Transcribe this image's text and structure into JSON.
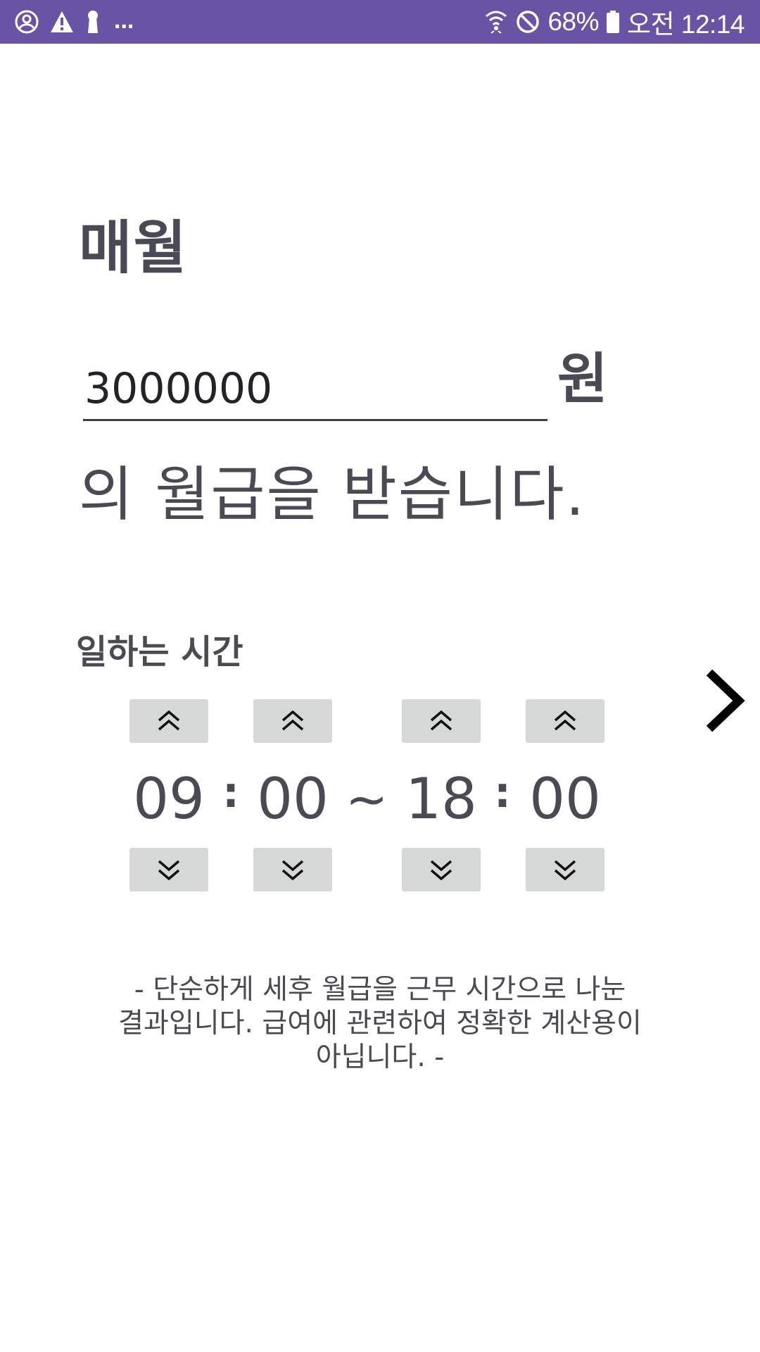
{
  "status_bar": {
    "left_icons": [
      "account-circle-icon",
      "warning-icon",
      "keyhole-icon"
    ],
    "overflow": "...",
    "right_icons": [
      "wifi-icon",
      "do-not-disturb-icon"
    ],
    "battery_percent": "68%",
    "time": "오전 12:14",
    "bar_color": "#6953a5"
  },
  "main": {
    "title": "매월",
    "salary_value": "3000000",
    "currency": "원",
    "sentence": "의 월급을 받습니다."
  },
  "work_hours": {
    "label": "일하는 시간",
    "start_hour": "09",
    "start_minute": "00",
    "end_hour": "18",
    "end_minute": "00",
    "colon": ":",
    "range_separator": "~",
    "up_icon": "double-chevron-up-icon",
    "down_icon": "double-chevron-down-icon"
  },
  "navigation": {
    "next_icon": "chevron-right-icon"
  },
  "disclaimer": {
    "line1": "- 단순하게 세후 월급을 근무 시간으로 나눈",
    "line2": "결과입니다. 급여에 관련하여 정확한 계산용이",
    "line3": "아닙니다. -"
  }
}
